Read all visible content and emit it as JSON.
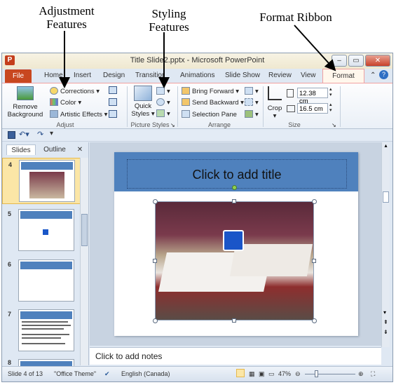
{
  "annotations": {
    "adjustment": [
      "Adjustment",
      "Features"
    ],
    "styling": [
      "Styling",
      "Features"
    ],
    "format_ribbon": "Format Ribbon"
  },
  "window": {
    "title": "Title Slide2.pptx  -  Microsoft PowerPoint",
    "app_icon": "P",
    "controls": [
      "–",
      "▭",
      "✕"
    ]
  },
  "tabs": [
    "Home",
    "Insert",
    "Design",
    "Transitions",
    "Animations",
    "Slide Show",
    "Review",
    "View"
  ],
  "file_tab": "File",
  "active_tab": "Format",
  "ribbon": {
    "adjust": {
      "label": "Adjust",
      "remove_bg": [
        "Remove",
        "Background"
      ],
      "corrections": "Corrections ▾",
      "color": "Color ▾",
      "artistic": "Artistic Effects ▾"
    },
    "picture_styles": {
      "label": "Picture Styles",
      "quick_styles": [
        "Quick",
        "Styles ▾"
      ]
    },
    "arrange": {
      "label": "Arrange",
      "bring_forward": "Bring Forward ▾",
      "send_backward": "Send Backward ▾",
      "selection_pane": "Selection Pane"
    },
    "size": {
      "label": "Size",
      "crop": "Crop",
      "height": "12.38 cm",
      "width": "16.5 cm"
    }
  },
  "pane": {
    "tab_slides": "Slides",
    "tab_outline": "Outline",
    "close": "✕",
    "thumbnails": [
      "4",
      "5",
      "6",
      "7",
      "8"
    ]
  },
  "slide": {
    "title_placeholder": "Click to add title"
  },
  "notes_placeholder": "Click to add notes",
  "status": {
    "slide_info": "Slide 4 of 13",
    "theme": "\"Office Theme\"",
    "language": "English (Canada)",
    "zoom": "47%"
  },
  "colors": {
    "accent": "#4f81bd",
    "file_tab": "#c8471f"
  }
}
